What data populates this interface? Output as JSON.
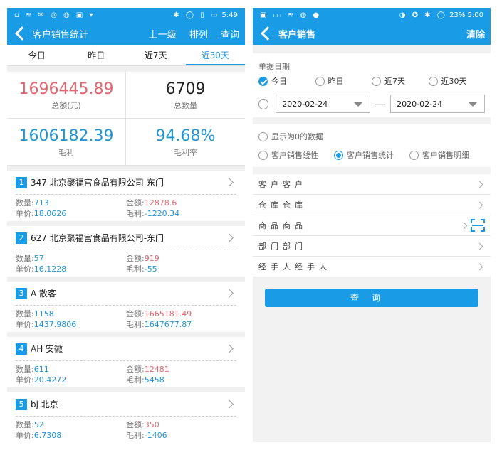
{
  "left": {
    "status": {
      "time": "5:49",
      "icons_left": "▫ ≋ ✉ ◎ ◍ ▣ ▾",
      "icons_right": "✱ ◯ ▯ ▭"
    },
    "header": {
      "title": "客户销售统计",
      "up": "上一级",
      "sort": "排列",
      "query": "查询"
    },
    "tabs": [
      "今日",
      "昨日",
      "近7天",
      "近30天"
    ],
    "active_tab": 3,
    "summary": [
      {
        "value": "1696445.89",
        "label": "总额(元)",
        "color": "red"
      },
      {
        "value": "6709",
        "label": "总数量",
        "color": "dark"
      },
      {
        "value": "1606182.39",
        "label": "毛利",
        "color": "blue"
      },
      {
        "value": "94.68%",
        "label": "毛利率",
        "color": "blue"
      }
    ],
    "records": [
      {
        "index": "1",
        "name": "347 北京聚福宫食品有限公司-东门",
        "qty_label": "数量:",
        "qty": "713",
        "amount_label": "金额:",
        "amount": "12878.6",
        "price_label": "单价:",
        "price": "18.0626",
        "profit_label": "毛利:",
        "profit": "-1220.34"
      },
      {
        "index": "2",
        "name": "627 北京聚福宫食品有限公司-东门",
        "qty_label": "数量:",
        "qty": "57",
        "amount_label": "金额:",
        "amount": "919",
        "price_label": "单价:",
        "price": "16.1228",
        "profit_label": "毛利:",
        "profit": "-55"
      },
      {
        "index": "3",
        "name": "A 散客",
        "qty_label": "数量:",
        "qty": "1158",
        "amount_label": "金额:",
        "amount": "1665181.49",
        "price_label": "单价:",
        "price": "1437.9806",
        "profit_label": "毛利:",
        "profit": "1647677.87"
      },
      {
        "index": "4",
        "name": "AH 安徽",
        "qty_label": "数量:",
        "qty": "611",
        "amount_label": "金额:",
        "amount": "12481",
        "price_label": "单价:",
        "price": "20.4272",
        "profit_label": "毛利:",
        "profit": "5458"
      },
      {
        "index": "5",
        "name": "bj 北京",
        "qty_label": "数量:",
        "qty": "52",
        "amount_label": "金额:",
        "amount": "350",
        "price_label": "单价:",
        "price": "6.7308",
        "profit_label": "毛利:",
        "profit": "-1406"
      }
    ]
  },
  "right": {
    "status": {
      "time": "5:00",
      "battery": "23%",
      "icons_left": "▣ ᵢₗₗ ≋ ◍ ●",
      "icons_right": "◑ ✪ ✱ ◯"
    },
    "header": {
      "title": "客户销售",
      "clear": "清除"
    },
    "date_section": {
      "label": "单据日期",
      "options": [
        "今日",
        "昨日",
        "近7天",
        "近30天"
      ],
      "selected": 0,
      "start_date": "2020-02-24",
      "dash": "—",
      "end_date": "2020-02-24"
    },
    "show_zero": "显示为0的数据",
    "report_types": [
      "客户销售线性",
      "客户销售统计",
      "客户销售明细"
    ],
    "report_selected": 1,
    "filters": [
      "客户客户",
      "仓库仓库",
      "商品商品",
      "部门部门",
      "经手人经手人"
    ],
    "query_button": "查询"
  },
  "colors": {
    "primary": "#1a9be6",
    "red": "#e5646e",
    "blue": "#1f95d8"
  }
}
